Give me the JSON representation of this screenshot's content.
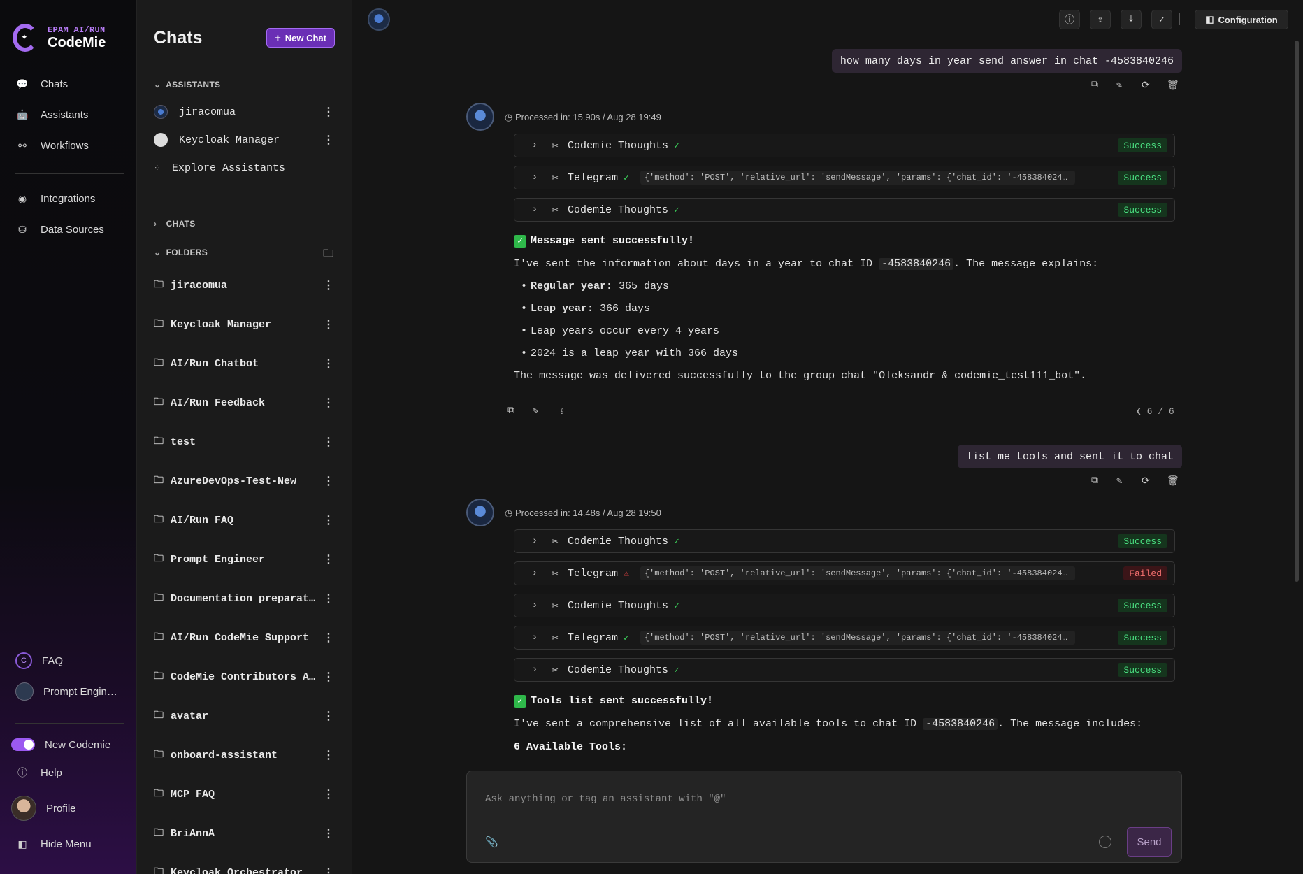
{
  "nav": {
    "brand_sub": "EPAM AI/RUN",
    "brand_name": "CodeMie",
    "items": [
      {
        "label": "Chats",
        "icon": "chat-icon"
      },
      {
        "label": "Assistants",
        "icon": "robot-icon"
      },
      {
        "label": "Workflows",
        "icon": "workflow-icon"
      },
      {
        "label": "Integrations",
        "icon": "integrations-icon"
      },
      {
        "label": "Data Sources",
        "icon": "database-icon"
      }
    ],
    "bottom": {
      "faq": "FAQ",
      "prompt_engineer": "Prompt Engin…",
      "new_codemie": "New Codemie",
      "help": "Help",
      "profile": "Profile",
      "hide_menu": "Hide Menu"
    },
    "accent": "#9b59f0"
  },
  "panel": {
    "title": "Chats",
    "new_chat": "New Chat",
    "assistants_header": "ASSISTANTS",
    "assistants": [
      "jiracomua",
      "Keycloak Manager"
    ],
    "explore": "Explore Assistants",
    "chats_header": "CHATS",
    "folders_header": "FOLDERS",
    "folders": [
      "jiracomua",
      "Keycloak Manager",
      "AI/Run Chatbot",
      "AI/Run Feedback",
      "test",
      "AzureDevOps-Test-New",
      "AI/Run FAQ",
      "Prompt Engineer",
      "Documentation preparat...",
      "AI/Run CodeMie Support",
      "CodeMie Contributors A...",
      "avatar",
      "onboard-assistant",
      "MCP FAQ",
      "BriAnnA",
      "Keycloak Orchestrator"
    ]
  },
  "topbar": {
    "configuration": "Configuration"
  },
  "conversation": {
    "msg1": "how many days in year send answer in chat -4583840246",
    "meta1": "Processed in: 15.90s / Aug 28 19:49",
    "tools1": [
      {
        "name": "Codemie Thoughts",
        "args": "",
        "status": "Success",
        "ok": true
      },
      {
        "name": "Telegram",
        "args": "{'method': 'POST', 'relative_url': 'sendMessage', 'params': {'chat_id': '-4583840246'...",
        "status": "Success",
        "ok": true
      },
      {
        "name": "Codemie Thoughts",
        "args": "",
        "status": "Success",
        "ok": true
      }
    ],
    "ans1_title": "Message sent successfully!",
    "ans1_intro_a": "I've sent the information about days in a year to chat ID",
    "ans1_chat_id": "-4583840246",
    "ans1_intro_b": ". The message explains:",
    "ans1_b1_label": "Regular year:",
    "ans1_b1_val": " 365 days",
    "ans1_b2_label": "Leap year:",
    "ans1_b2_val": " 366 days",
    "ans1_b3": "Leap years occur every 4 years",
    "ans1_b4": "2024 is a leap year with 366 days",
    "ans1_outro": "The message was delivered successfully to the group chat \"Oleksandr & codemie_test111_bot\".",
    "pager": "❮ 6 / 6",
    "msg2": "list me tools and sent it to chat",
    "meta2": "Processed in: 14.48s / Aug 28 19:50",
    "tools2": [
      {
        "name": "Codemie Thoughts",
        "args": "",
        "status": "Success",
        "ok": true
      },
      {
        "name": "Telegram",
        "args": "{'method': 'POST', 'relative_url': 'sendMessage', 'params': {'chat_id': '-4583840246'...",
        "status": "Failed",
        "ok": false
      },
      {
        "name": "Codemie Thoughts",
        "args": "",
        "status": "Success",
        "ok": true
      },
      {
        "name": "Telegram",
        "args": "{'method': 'POST', 'relative_url': 'sendMessage', 'params': {'chat_id': '-4583840246'...",
        "status": "Success",
        "ok": true
      },
      {
        "name": "Codemie Thoughts",
        "args": "",
        "status": "Success",
        "ok": true
      }
    ],
    "ans2_title": "Tools list sent successfully!",
    "ans2_intro_a": "I've sent a comprehensive list of all available tools to chat ID",
    "ans2_chat_id": "-4583840246",
    "ans2_intro_b": ". The message includes:",
    "ans2_sub": "6 Available Tools:"
  },
  "composer": {
    "placeholder": "Ask anything or tag an assistant with \"@\"",
    "send": "Send"
  }
}
